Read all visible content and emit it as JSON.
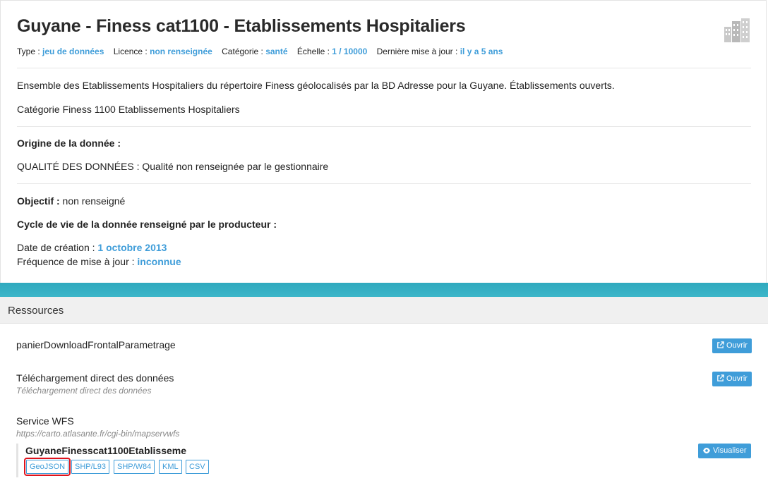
{
  "dataset": {
    "title": "Guyane - Finess cat1100 - Etablissements Hospitaliers",
    "meta": [
      {
        "label": "Type : ",
        "value": "jeu de données"
      },
      {
        "label": "Licence : ",
        "value": "non renseignée"
      },
      {
        "label": "Catégorie : ",
        "value": "santé"
      },
      {
        "label": "Échelle : ",
        "value": "1 / 10000"
      },
      {
        "label": "Dernière mise à jour : ",
        "value": "il y a 5 ans"
      }
    ],
    "description": "Ensemble des Etablissements Hospitaliers du répertoire Finess géolocalisés par la BD Adresse pour la Guyane. Établissements ouverts.",
    "category_line": "Catégorie Finess 1100 Etablissements Hospitaliers",
    "origin_heading": "Origine de la donnée :",
    "origin_text": "QUALITÉ DES DONNÉES : Qualité non renseignée par le gestionnaire",
    "objective_label": "Objectif :",
    "objective_value": " non renseigné",
    "lifecycle_heading": "Cycle de vie de la donnée renseigné par le producteur :",
    "creation_label": "Date de création : ",
    "creation_value": "1 octobre 2013",
    "frequency_label": "Fréquence de mise à jour : ",
    "frequency_value": "inconnue"
  },
  "resources": {
    "header": "Ressources",
    "items": [
      {
        "title": "panierDownloadFrontalParametrage",
        "subtitle": "",
        "button": "Ouvrir"
      },
      {
        "title": "Téléchargement direct des données",
        "subtitle": "Téléchargement direct des données",
        "button": "Ouvrir"
      },
      {
        "title": "Service WFS",
        "subtitle": "https://carto.atlasante.fr/cgi-bin/mapservwfs",
        "button": ""
      }
    ],
    "layer": {
      "name": "GuyaneFinesscat1100Etablisseme",
      "visualize_label": "Visualiser",
      "formats": [
        "GeoJSON",
        "SHP/L93",
        "SHP/W84",
        "KML",
        "CSV"
      ],
      "selected_format": "GeoJSON"
    }
  },
  "colors": {
    "accent": "#3f9dd9",
    "teal_band": "#36b0c4",
    "highlight": "#e0121b"
  },
  "icons": [
    "building-icon",
    "external-link-icon",
    "eye-icon"
  ]
}
